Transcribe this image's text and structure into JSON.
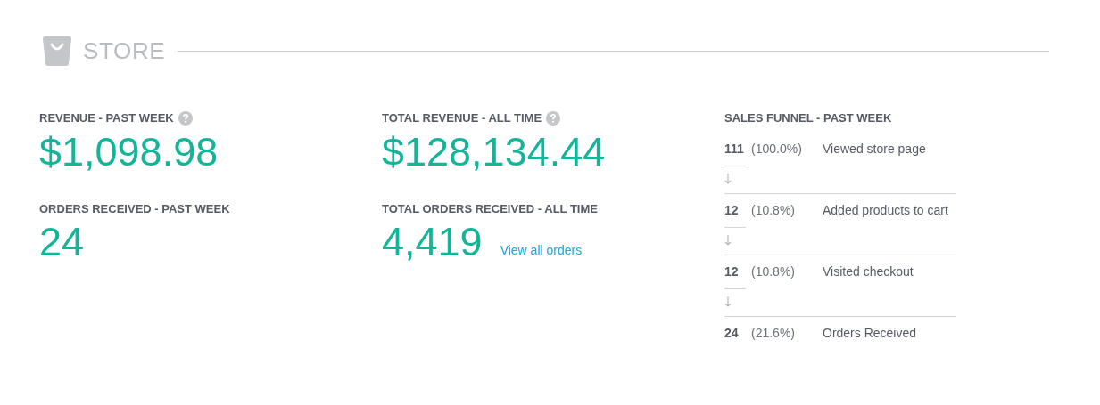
{
  "section": {
    "title": "STORE"
  },
  "columns": [
    {
      "metrics": [
        {
          "label": "REVENUE - PAST WEEK",
          "help": true,
          "value": "$1,098.98"
        },
        {
          "label": "ORDERS RECEIVED - PAST WEEK",
          "help": false,
          "value": "24"
        }
      ]
    },
    {
      "metrics": [
        {
          "label": "TOTAL REVENUE - ALL TIME",
          "help": true,
          "value": "$128,134.44"
        },
        {
          "label": "TOTAL ORDERS RECEIVED - ALL TIME",
          "help": false,
          "value": "4,419",
          "link": "View all orders"
        }
      ]
    }
  ],
  "funnel": {
    "title": "SALES FUNNEL - PAST WEEK",
    "steps": [
      {
        "count": "111",
        "percent": "(100.0%)",
        "label": "Viewed store page"
      },
      {
        "count": "12",
        "percent": "(10.8%)",
        "label": "Added products to cart"
      },
      {
        "count": "12",
        "percent": "(10.8%)",
        "label": "Visited checkout"
      },
      {
        "count": "24",
        "percent": "(21.6%)",
        "label": "Orders Received"
      }
    ]
  }
}
